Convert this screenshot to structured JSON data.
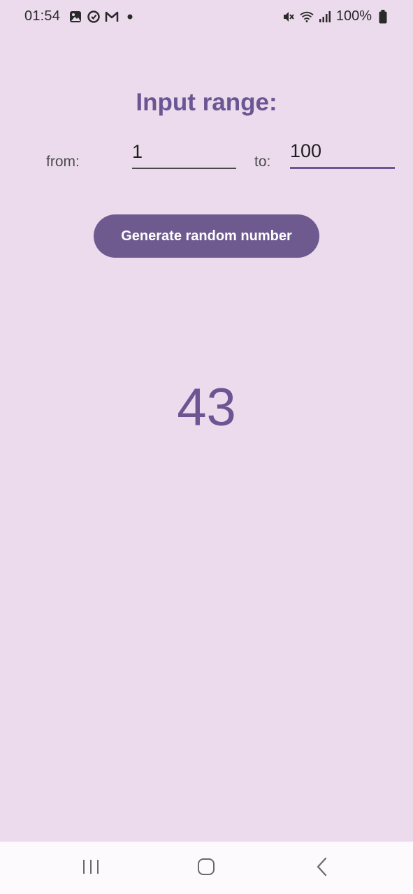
{
  "status_bar": {
    "time": "01:54",
    "left_icons": [
      "gallery-icon",
      "sync-icon",
      "gmail-icon",
      "dot-icon"
    ],
    "right_icons": [
      "mute-icon",
      "wifi-icon",
      "signal-icon",
      "battery-icon"
    ],
    "battery": "100%"
  },
  "main": {
    "title": "Input range:",
    "from_label": "from:",
    "from_value": "1",
    "to_label": "to:",
    "to_value": "100",
    "generate_label": "Generate random number",
    "result": "43"
  },
  "nav_bar": {
    "icons": [
      "recents-icon",
      "home-icon",
      "back-icon"
    ]
  },
  "colors": {
    "background": "#ecdbec",
    "accent": "#6b5693",
    "button": "#6e5a8f"
  }
}
